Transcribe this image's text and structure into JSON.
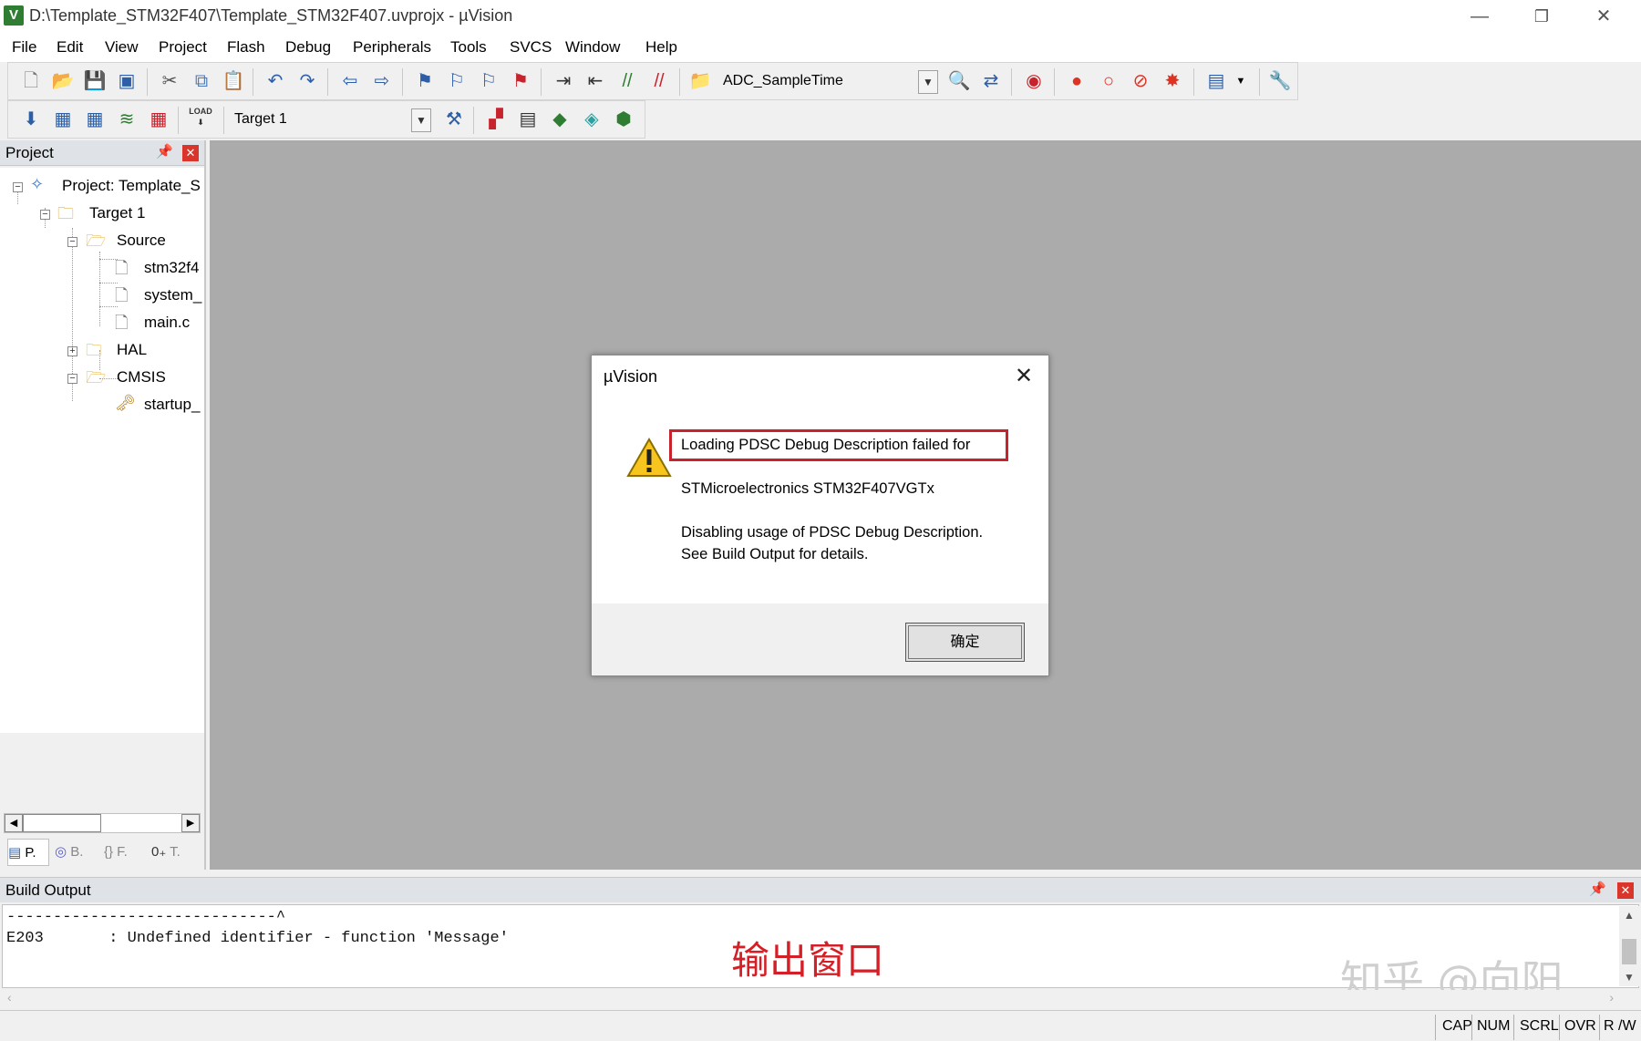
{
  "window": {
    "title": "D:\\Template_STM32F407\\Template_STM32F407.uvprojx - µVision",
    "logo": "V",
    "controls": {
      "minimize": "—",
      "restore": "❐",
      "close": "✕"
    }
  },
  "menu": [
    "File",
    "Edit",
    "View",
    "Project",
    "Flash",
    "Debug",
    "Peripherals",
    "Tools",
    "SVCS",
    "Window",
    "Help"
  ],
  "toolbar1": {
    "find_combo_value": "ADC_SampleTime"
  },
  "toolbar2": {
    "load_label": "LOAD",
    "target_combo_value": "Target 1"
  },
  "project_panel": {
    "title": "Project",
    "root": "Project: Template_S",
    "target": "Target 1",
    "groups": {
      "source": {
        "label": "Source",
        "files": [
          "stm32f4",
          "system_",
          "main.c"
        ]
      },
      "hal": {
        "label": "HAL"
      },
      "cmsis": {
        "label": "CMSIS",
        "files": [
          "startup_"
        ]
      }
    },
    "tabs": [
      "P.",
      "B.",
      "{} F.",
      "T."
    ]
  },
  "dialog": {
    "title": "µVision",
    "line1": "Loading PDSC Debug Description failed for",
    "line2": "STMicroelectronics STM32F407VGTx",
    "line3": "Disabling usage of PDSC Debug Description.",
    "line4": "See Build Output for details.",
    "ok_label": "确定"
  },
  "build_output": {
    "title": "Build Output",
    "lines": [
      "-----------------------------^",
      "E203       : Undefined identifier - function 'Message'"
    ],
    "annotation": "输出窗口",
    "watermark": "知乎 @向阳"
  },
  "status": [
    "CAP",
    "NUM",
    "SCRL",
    "OVR",
    "R /W"
  ],
  "colors": {
    "highlight_border": "#c8232c",
    "annotation": "#d41f26",
    "close_red": "#d9352b"
  }
}
